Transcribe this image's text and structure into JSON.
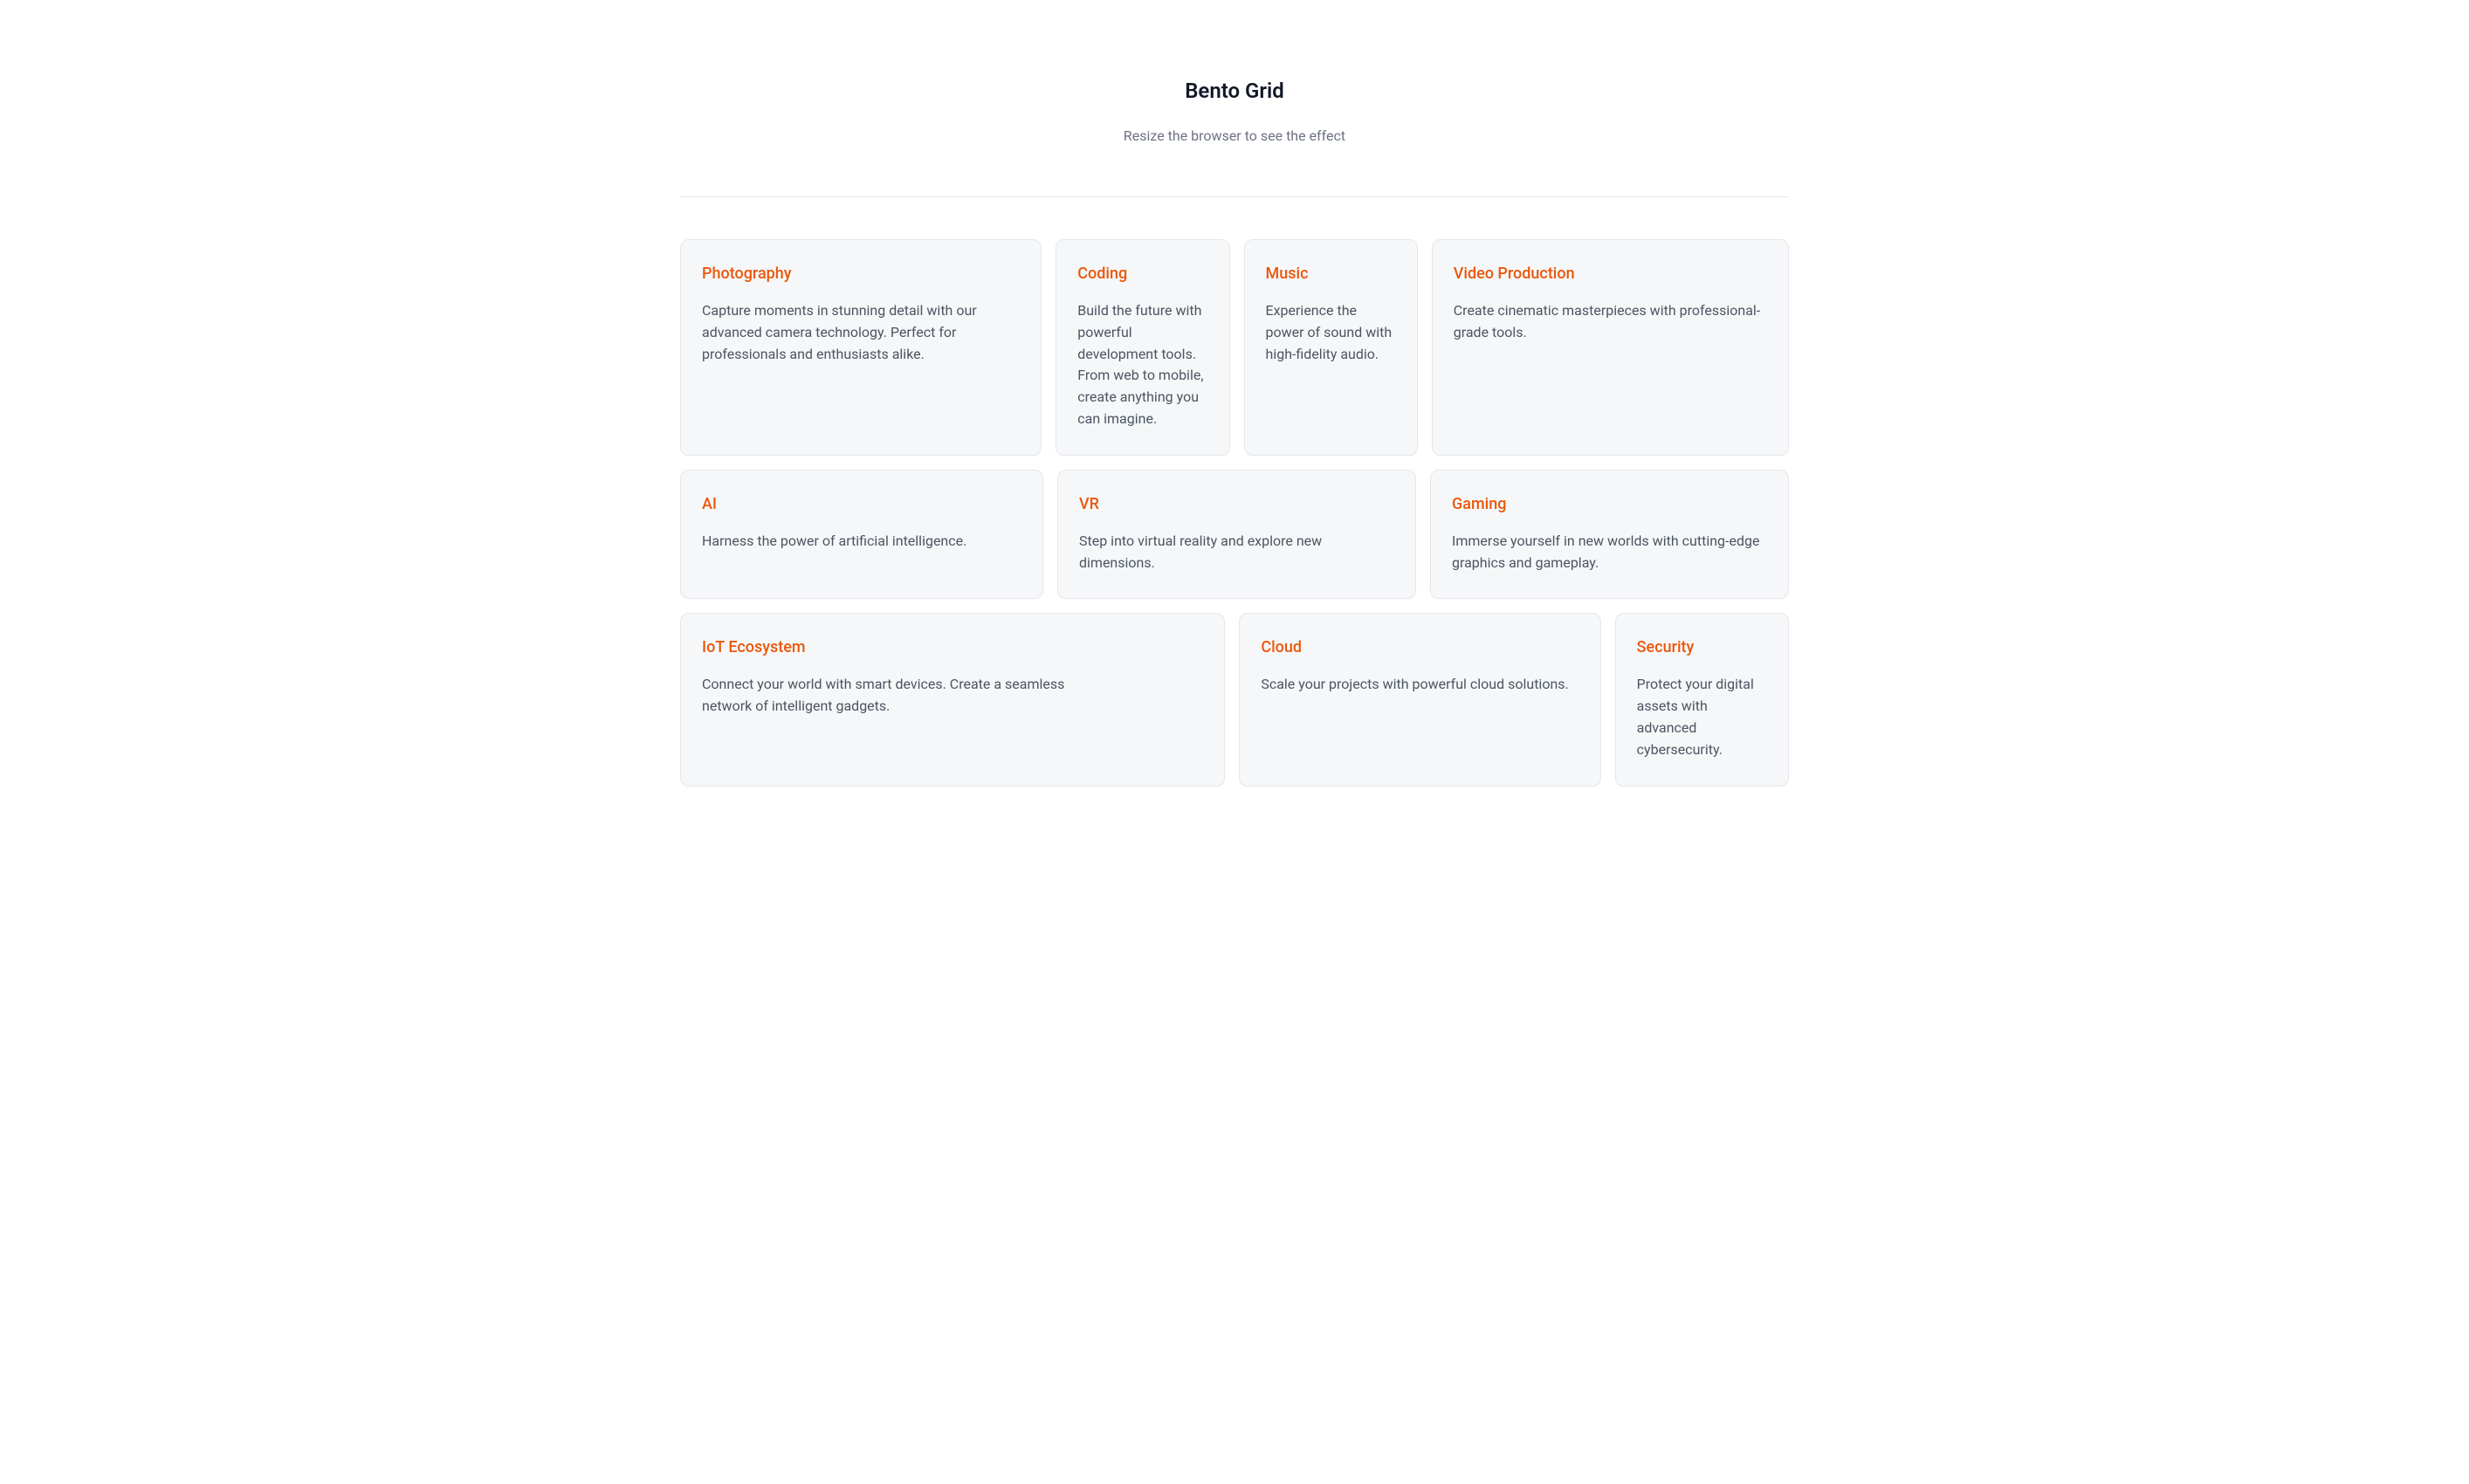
{
  "header": {
    "title": "Bento Grid",
    "subtitle": "Resize the browser to see the effect"
  },
  "cards": {
    "photography": {
      "title": "Photography",
      "desc": "Capture moments in stunning detail with our advanced camera technology. Perfect for professionals and enthusiasts alike."
    },
    "coding": {
      "title": "Coding",
      "desc": "Build the future with powerful development tools. From web to mobile, create anything you can imagine."
    },
    "music": {
      "title": "Music",
      "desc": "Experience the power of sound with high-fidelity audio."
    },
    "video": {
      "title": "Video Production",
      "desc": "Create cinematic masterpieces with professional-grade tools."
    },
    "ai": {
      "title": "AI",
      "desc": "Harness the power of artificial intelligence."
    },
    "vr": {
      "title": "VR",
      "desc": "Step into virtual reality and explore new dimensions."
    },
    "gaming": {
      "title": "Gaming",
      "desc": "Immerse yourself in new worlds with cutting-edge graphics and gameplay."
    },
    "iot": {
      "title": "IoT Ecosystem",
      "desc": "Connect your world with smart devices. Create a seamless network of intelligent gadgets."
    },
    "cloud": {
      "title": "Cloud",
      "desc": "Scale your projects with powerful cloud solutions."
    },
    "security": {
      "title": "Security",
      "desc": "Protect your digital assets with advanced cybersecurity."
    }
  }
}
